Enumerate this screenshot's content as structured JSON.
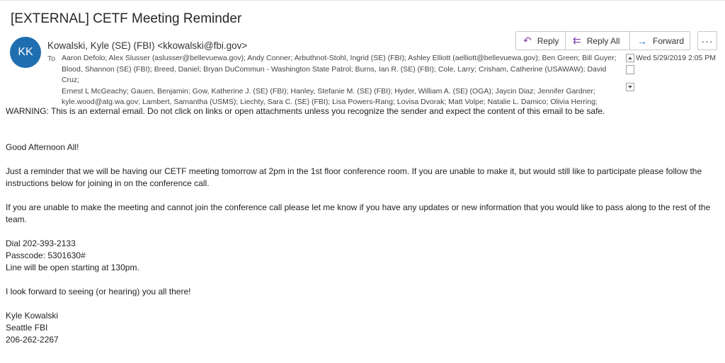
{
  "email": {
    "subject": "[EXTERNAL] CETF Meeting Reminder",
    "avatar_initials": "KK",
    "sender": "Kowalski, Kyle (SE) (FBI) <kkowalski@fbi.gov>",
    "to_label": "To",
    "recipients_lines": [
      "Aaron Defolo; Alex Slusser (aslusser@bellevuewa.gov); Andy Conner; Arbuthnot-Stohl, Ingrid (SE) (FBI); Ashley Elliott (aelliott@bellevuewa.gov); Ben Green; Bill Guyer;",
      "Blood, Shannon (SE) (FBI); Breed, Daniel; Bryan DuCommun - Washington State Patrol; Burns, Ian R. (SE) (FBI); Cole, Larry; Crisham, Catherine (USAWAW); David Cruz;",
      "Ernest L McGeachy; Gauen, Benjamin; Gow, Katherine J. (SE) (FBI); Hanley, Stefanie M. (SE) (FBI); Hyder, William A. (SE) (OGA); Jaycin Diaz; Jennifer Gardner;",
      "kyle.wood@atg.wa.gov; Lambert, Samantha (USMS); Liechty, Sara C. (SE) (FBI); Lisa Powers-Rang; Lovisa Dvorak; Matt Volpe; Natalie L. Damico; Olivia Herring;"
    ],
    "date": "Wed 5/29/2019 2:05 PM"
  },
  "actions": {
    "reply": "Reply",
    "reply_all": "Reply All",
    "forward": "Forward",
    "more": "···",
    "reply_icon": "reply-arrow-icon",
    "reply_all_icon": "reply-all-arrow-icon",
    "forward_icon": "forward-arrow-icon"
  },
  "body": {
    "warning": "WARNING: This is an external email. Do not click on links or open attachments unless you recognize the sender and expect the content of this email to be safe.",
    "greeting": "Good Afternoon All!",
    "para1": "Just a reminder that we will be having our CETF meeting tomorrow at 2pm in the 1st floor conference room. If you are unable to make it, but would still like to participate please follow the instructions below for joining in on the conference call.",
    "para2": "If you are unable to make the meeting and cannot join the conference call please let me know if you have any updates or new information that you would like to pass along to the rest of the team.",
    "dial": "Dial 202-393-2133",
    "passcode": "Passcode: 5301630#",
    "line_open": "Line will be open starting at 130pm.",
    "closing": "I look forward to seeing (or hearing) you all there!",
    "sig_name": "Kyle Kowalski",
    "sig_org": "Seattle FBI",
    "sig_phone": "206-262-2267"
  },
  "colors": {
    "avatar": "#1e6eb0",
    "reply_icon": "#7a3fa8",
    "forward_icon": "#2a6fc2"
  }
}
